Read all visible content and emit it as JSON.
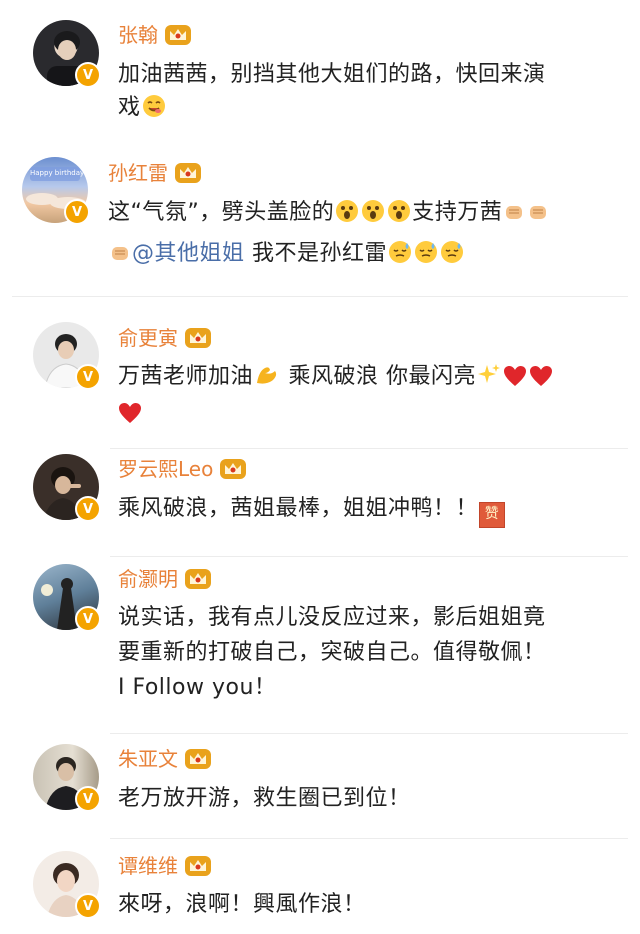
{
  "comments": [
    {
      "name": "张翰",
      "lines": [
        {
          "t": "加油茜茜，别挡其他大姐们的路，快回来演"
        },
        {
          "t": "戏",
          "after": [
            "emoji-yum"
          ]
        }
      ]
    },
    {
      "name": "孙红雷",
      "avatar_text": "Happy birthday",
      "lines": [
        {
          "t1": "这“气氛”，劈头盖脸的",
          "after1": [
            "emoji-shocked",
            "emoji-shocked",
            "emoji-shocked"
          ],
          "t2": "支持万茜",
          "after2": [
            "emoji-fist",
            "emoji-fist"
          ]
        },
        {
          "before": [
            "emoji-fist"
          ],
          "mention": "@其他姐姐",
          "t": " 我不是孙红雷",
          "after": [
            "emoji-sweat",
            "emoji-sweat",
            "emoji-sweat"
          ]
        }
      ]
    },
    {
      "name": "俞更寅",
      "lines": [
        {
          "t1": "万茜老师加油",
          "after1": [
            "emoji-muscle"
          ],
          "t2": " 乘风破浪 你最闪亮",
          "after2": [
            "emoji-sparkles",
            "emoji-heart",
            "emoji-heart"
          ]
        },
        {
          "after": [
            "emoji-heart"
          ]
        }
      ]
    },
    {
      "name": "罗云熙Leo",
      "lines": [
        {
          "t": "乘风破浪，茜姐最棒，姐姐冲鸭！！",
          "after": [
            "emoji-zan"
          ]
        }
      ],
      "zan": "赞"
    },
    {
      "name": "俞灏明",
      "lines": [
        {
          "t": "说实话，我有点儿没反应过来，影后姐姐竟"
        },
        {
          "t": "要重新的打破自己，突破自己。值得敬佩！"
        },
        {
          "t": "I Follow you！"
        }
      ]
    },
    {
      "name": "朱亚文",
      "lines": [
        {
          "t": "老万放开游，救生圈已到位！"
        }
      ]
    },
    {
      "name": "谭维维",
      "lines": [
        {
          "t": "來呀，浪啊！興風作浪！"
        }
      ]
    }
  ],
  "colors": {
    "name": "#e8823a",
    "text": "#222222",
    "mention": "#4a6ea8",
    "badge": "#f4a300",
    "crown": "#e9a21c"
  }
}
